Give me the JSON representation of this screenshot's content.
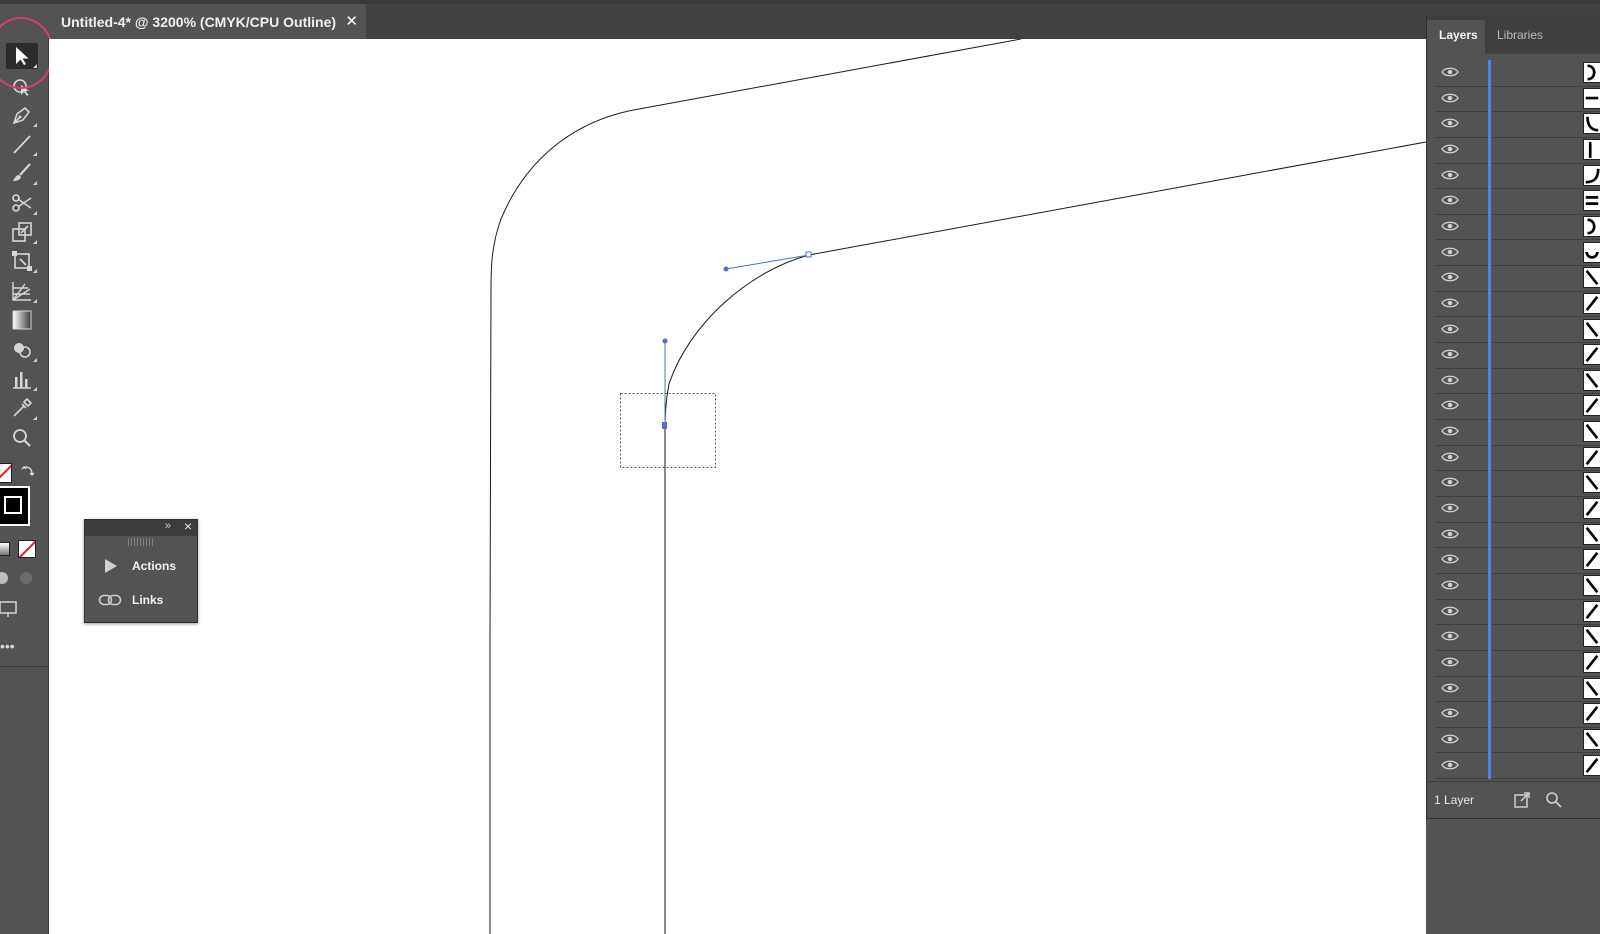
{
  "document_tab": {
    "title": "Untitled-4* @ 3200% (CMYK/CPU Outline)",
    "close_glyph": "✕"
  },
  "toolbar": {
    "tools": [
      {
        "name": "selection-tool",
        "icon": "arrow-pointer-icon",
        "active": true
      },
      {
        "name": "puppet-warp-tool",
        "icon": "puppet-warp-icon"
      },
      {
        "name": "pen-tool",
        "icon": "pen-icon"
      },
      {
        "name": "line-segment-tool",
        "icon": "line-icon"
      },
      {
        "name": "paintbrush-tool",
        "icon": "paintbrush-icon"
      },
      {
        "name": "scissors-tool",
        "icon": "scissors-icon"
      },
      {
        "name": "scale-tool",
        "icon": "scale-icon"
      },
      {
        "name": "free-transform-tool",
        "icon": "free-transform-icon"
      },
      {
        "name": "perspective-grid-tool",
        "icon": "perspective-grid-icon"
      },
      {
        "name": "gradient-tool",
        "icon": "gradient-icon"
      },
      {
        "name": "shape-builder-tool",
        "icon": "shape-builder-icon"
      },
      {
        "name": "graph-tool",
        "icon": "bar-graph-icon"
      },
      {
        "name": "eyedropper-tool",
        "icon": "eyedropper-icon"
      },
      {
        "name": "zoom-tool",
        "icon": "magnifier-icon"
      }
    ]
  },
  "actions_panel": {
    "items": [
      {
        "label": "Actions",
        "icon": "play-icon"
      },
      {
        "label": "Links",
        "icon": "chain-link-icon"
      }
    ]
  },
  "layers_panel": {
    "tabs": [
      {
        "label": "Layers",
        "active": true
      },
      {
        "label": "Libraries",
        "active": false
      }
    ],
    "row_count": 28,
    "layer_count_label": "1 Layer",
    "accent_color": "#4f82e6"
  },
  "colors": {
    "ui_bg": "#535353",
    "canvas": "#ffffff",
    "selection_highlight": "#d93b7a",
    "anchor_blue": "#4f6fd6"
  }
}
